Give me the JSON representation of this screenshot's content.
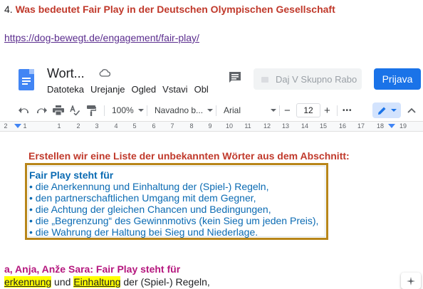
{
  "task": {
    "number": "4.",
    "title": "Was bedeutet Fair Play in der Deutschen Olympischen Gesellschaft"
  },
  "link": {
    "text": "https://dog-bewegt.de/engagement/fair-play/"
  },
  "docs": {
    "doc_title": "Wort...",
    "menu": [
      "Datoteka",
      "Urejanje",
      "Ogled",
      "Vstavi",
      "Obl"
    ],
    "share_label": "Daj V Skupno Rabo",
    "login_label": "Prijava",
    "toolbar": {
      "zoom": "100%",
      "style": "Navadno b...",
      "font": "Arial",
      "font_size": "12",
      "minus": "−",
      "plus": "+",
      "more": "•••"
    },
    "ruler_ticks": [
      "2",
      "1",
      "1",
      "2",
      "3",
      "4",
      "5",
      "6",
      "7",
      "8",
      "9",
      "10",
      "11",
      "12",
      "13",
      "14",
      "15",
      "16",
      "17",
      "18",
      "19"
    ]
  },
  "content": {
    "subheading": "Erstellen wir eine Liste der unbekannten Wörter aus dem Abschnitt:",
    "box_title": "Fair Play steht für",
    "box_lines": [
      "• die Anerkennung und Einhaltung der (Spiel-) Regeln,",
      "• den partnerschaftlichen Umgang mit dem Gegner,",
      "• die Achtung der gleichen Chancen und Bedingungen,",
      "• die „Begrenzung“ des Gewinnmotivs (kein Sieg um jeden Preis),",
      "• die Wahrung der Haltung bei Sieg und Niederlage."
    ],
    "names_line": "a, Anja, Anže Sara: Fair Play steht für",
    "bottom": {
      "word1": "erkennung",
      "mid": " und ",
      "word2": "Einhaltung",
      "rest": " der (Spiel-) Regeln,"
    }
  },
  "colors": {
    "heading_red": "#c0392b",
    "box_blue": "#0b6bb3",
    "box_border": "#b8861a",
    "names_magenta": "#b5177e",
    "highlight": "#ffff00",
    "brand_blue": "#1a73e8"
  }
}
